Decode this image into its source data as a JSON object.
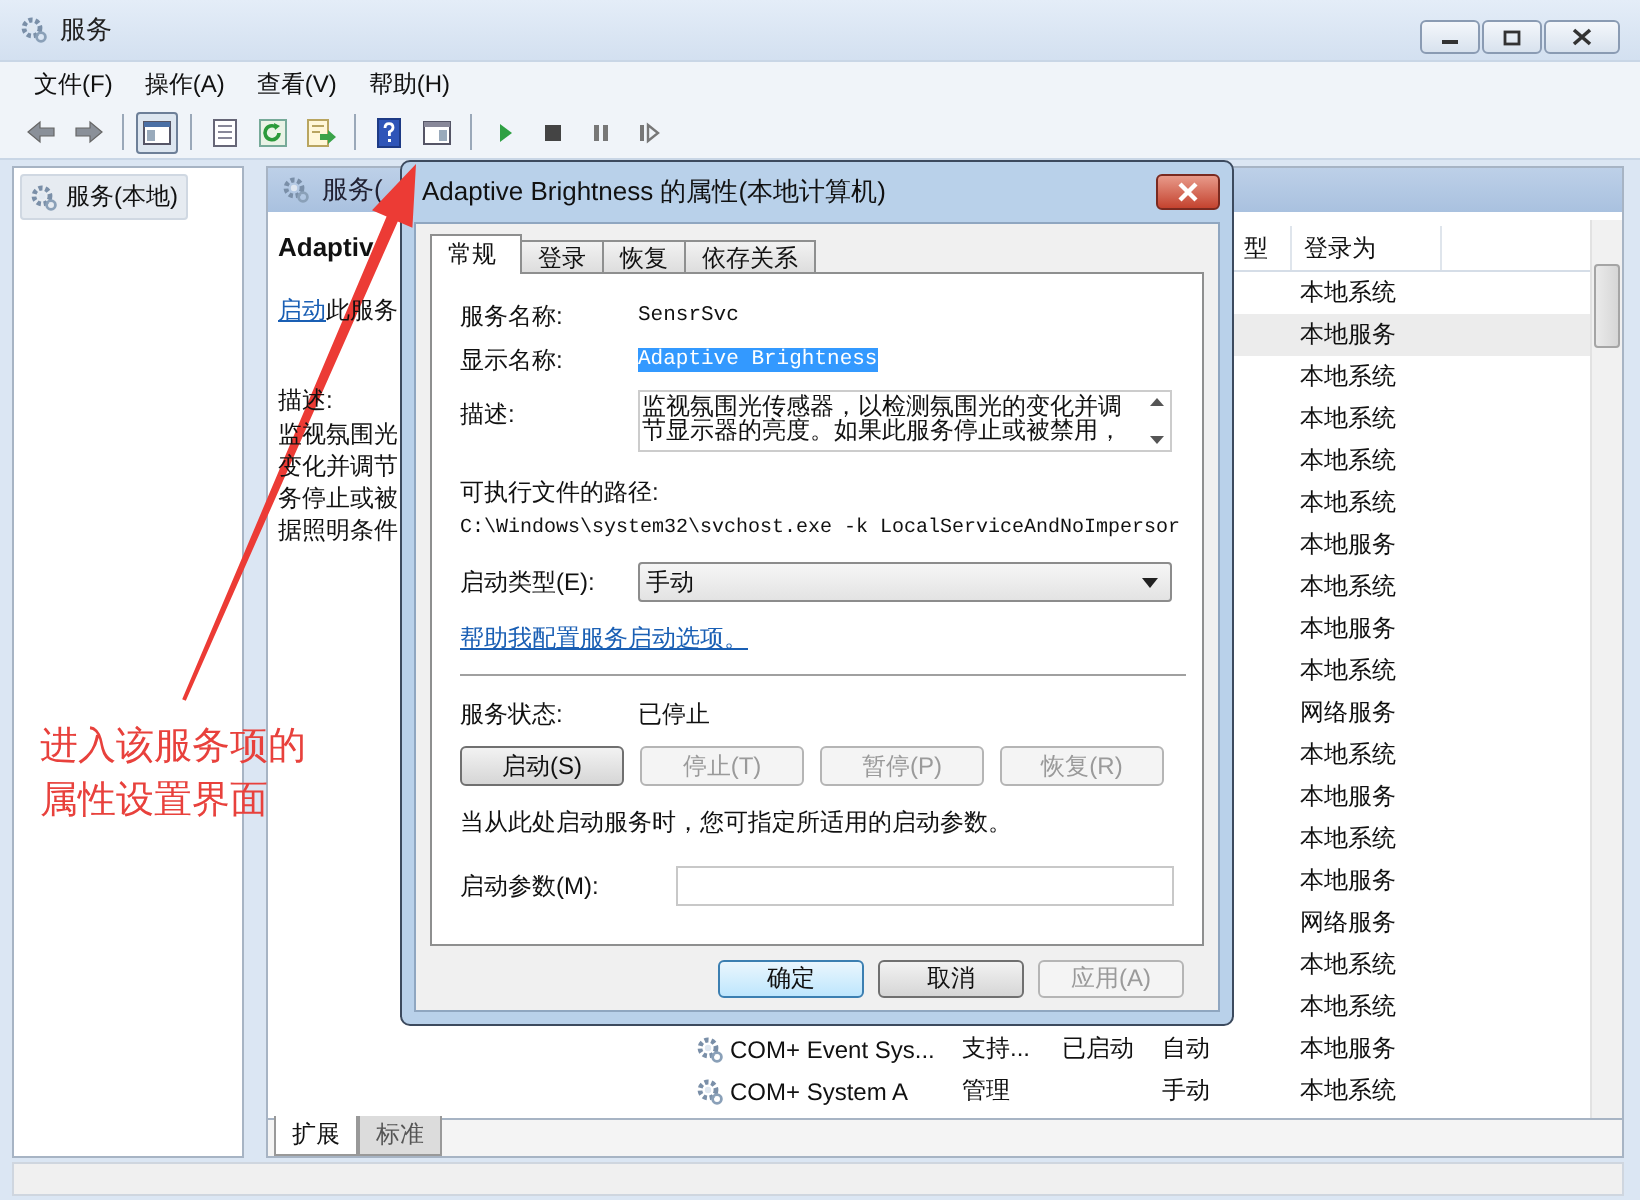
{
  "window": {
    "title": "服务"
  },
  "menu": [
    {
      "label": "文件(F)"
    },
    {
      "label": "操作(A)"
    },
    {
      "label": "查看(V)"
    },
    {
      "label": "帮助(H)"
    }
  ],
  "toolbar": [
    {
      "kind": "back",
      "pressed": false
    },
    {
      "kind": "forward",
      "pressed": false
    },
    {
      "kind": "separator"
    },
    {
      "kind": "console-tree",
      "pressed": true
    },
    {
      "kind": "separator"
    },
    {
      "kind": "properties",
      "pressed": false
    },
    {
      "kind": "refresh",
      "pressed": false
    },
    {
      "kind": "export",
      "pressed": false
    },
    {
      "kind": "separator"
    },
    {
      "kind": "help",
      "pressed": false
    },
    {
      "kind": "action-pane",
      "pressed": false
    },
    {
      "kind": "separator"
    },
    {
      "kind": "start",
      "pressed": false
    },
    {
      "kind": "stop",
      "pressed": false
    },
    {
      "kind": "pause",
      "pressed": false
    },
    {
      "kind": "resume",
      "pressed": false
    }
  ],
  "tree": {
    "items": [
      {
        "label": "服务(本地)",
        "selected": true
      }
    ]
  },
  "details": {
    "header": "服务(",
    "service_name": "Adaptiv",
    "action_link": "启动",
    "action_rest": "此服务",
    "description_label": "描述:",
    "description_lines": [
      "监视氛围光",
      "变化并调节",
      "务停止或被",
      "据照明条件"
    ]
  },
  "list": {
    "columns": [
      {
        "label": "型"
      },
      {
        "label": "登录为"
      }
    ],
    "rows": [
      {
        "log_on_as": "本地系统",
        "selected": false
      },
      {
        "log_on_as": "本地服务",
        "selected": true
      },
      {
        "log_on_as": "本地系统",
        "selected": false
      },
      {
        "log_on_as": "本地系统",
        "selected": false
      },
      {
        "log_on_as": "本地系统",
        "selected": false
      },
      {
        "log_on_as": "本地系统",
        "selected": false
      },
      {
        "log_on_as": "本地服务",
        "selected": false
      },
      {
        "log_on_as": "本地系统",
        "selected": false
      },
      {
        "log_on_as": "本地服务",
        "selected": false
      },
      {
        "log_on_as": "本地系统",
        "selected": false
      },
      {
        "log_on_as": "网络服务",
        "selected": false
      },
      {
        "log_on_as": "本地系统",
        "selected": false
      },
      {
        "log_on_as": "本地服务",
        "selected": false
      },
      {
        "log_on_as": "本地系统",
        "selected": false
      },
      {
        "log_on_as": "本地服务",
        "selected": false
      },
      {
        "log_on_as": "网络服务",
        "selected": false
      },
      {
        "log_on_as": "本地系统",
        "selected": false
      },
      {
        "log_on_as": "本地系统",
        "selected": false
      },
      {
        "name": "COM+ Event Sys...",
        "description": "支持...",
        "status": "已启动",
        "startup_type": "自动",
        "log_on_as": "本地服务",
        "selected": false
      },
      {
        "name": "COM+ System A",
        "description": "管理",
        "startup_type": "手动",
        "log_on_as": "本地系统",
        "selected": false
      }
    ]
  },
  "view_tabs": [
    {
      "label": "扩展",
      "selected": true
    },
    {
      "label": "标准",
      "selected": false
    }
  ],
  "dialog": {
    "title": "Adaptive Brightness 的属性(本地计算机)",
    "tabs": [
      {
        "label": "常规",
        "selected": true
      },
      {
        "label": "登录",
        "selected": false
      },
      {
        "label": "恢复",
        "selected": false
      },
      {
        "label": "依存关系",
        "selected": false
      }
    ],
    "service_name": {
      "label": "服务名称:",
      "value": "SensrSvc"
    },
    "display_name": {
      "label": "显示名称:",
      "value": "Adaptive Brightness",
      "selected": true
    },
    "description": {
      "label": "描述:",
      "value": "监视氛围光传感器，以检测氛围光的变化并调节显示器的亮度。如果此服务停止或被禁用，"
    },
    "path_label": "可执行文件的路径:",
    "path": "C:\\Windows\\system32\\svchost.exe -k LocalServiceAndNoImpersor",
    "startup_type": {
      "label": "启动类型(E):",
      "value": "手动"
    },
    "help_link": "帮助我配置服务启动选项。",
    "status": {
      "label": "服务状态:",
      "value": "已停止"
    },
    "control_buttons": [
      {
        "label": "启动(S)",
        "disabled": false
      },
      {
        "label": "停止(T)",
        "disabled": true
      },
      {
        "label": "暂停(P)",
        "disabled": true
      },
      {
        "label": "恢复(R)",
        "disabled": true
      }
    ],
    "note": "当从此处启动服务时，您可指定所适用的启动参数。",
    "parameters": {
      "label": "启动参数(M):"
    },
    "buttons": [
      {
        "label": "确定",
        "default": true,
        "disabled": false
      },
      {
        "label": "取消",
        "default": false,
        "disabled": false
      },
      {
        "label": "应用(A)",
        "default": false,
        "disabled": true
      }
    ]
  },
  "annotation": {
    "text": "进入该服务项的属性设置界面"
  }
}
